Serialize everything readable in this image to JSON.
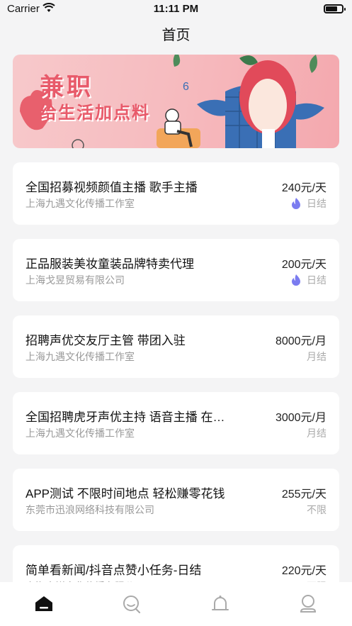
{
  "status": {
    "carrier": "Carrier",
    "time": "11:11 PM"
  },
  "nav": {
    "title": "首页"
  },
  "banner": {
    "line1": "兼职",
    "line2": "给生活加点料"
  },
  "jobs": [
    {
      "title": "全国招募视频颜值主播 歌手主播",
      "company": "上海九遇文化传播工作室",
      "salary": "240元/天",
      "settle": "日结",
      "hot": true
    },
    {
      "title": "正品服装美妆童装品牌特卖代理",
      "company": "上海戈昱贸易有限公司",
      "salary": "200元/天",
      "settle": "日结",
      "hot": true
    },
    {
      "title": "招聘声优交友厅主管 带团入驻",
      "company": "上海九遇文化传播工作室",
      "salary": "8000元/月",
      "settle": "月结",
      "hot": false
    },
    {
      "title": "全国招聘虎牙声优主持 语音主播 在…",
      "company": "上海九遇文化传播工作室",
      "salary": "3000元/月",
      "settle": "月结",
      "hot": false
    },
    {
      "title": "APP测试 不限时间地点 轻松赚零花钱",
      "company": "东莞市迅浪网络科技有限公司",
      "salary": "255元/天",
      "settle": "不限",
      "hot": false
    },
    {
      "title": "简单看新闻/抖音点赞小任务-日结",
      "company": "上海意祥文化传播有限公司",
      "salary": "220元/天",
      "settle": "不限",
      "hot": false
    }
  ],
  "tabs": [
    {
      "icon": "home-icon",
      "active": true
    },
    {
      "icon": "search-icon",
      "active": false
    },
    {
      "icon": "bell-icon",
      "active": false
    },
    {
      "icon": "user-icon",
      "active": false
    }
  ],
  "colors": {
    "accent": "#e85a6a",
    "hot": "#7b7cf0",
    "background": "#f4f4f5"
  }
}
